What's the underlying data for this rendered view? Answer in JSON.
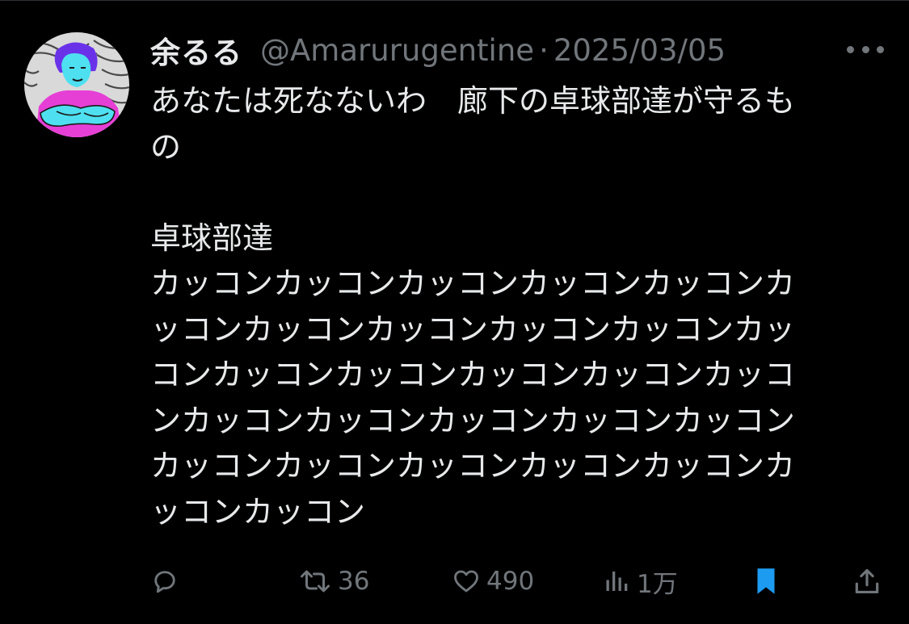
{
  "tweet": {
    "display_name": "余るる",
    "handle": "@Amarurugentine",
    "separator": "·",
    "date": "2025/03/05",
    "lines": [
      "あなたは死なないわ　廊下の卓球部達が守るも",
      "の",
      "",
      "卓球部達",
      "カッコンカッコンカッコンカッコンカッコンカ",
      "ッコンカッコンカッコンカッコンカッコンカッ",
      "コンカッコンカッコンカッコンカッコンカッコ",
      "ンカッコンカッコンカッコンカッコンカッコン",
      "カッコンカッコンカッコンカッコンカッコンカ",
      "ッコンカッコン"
    ]
  },
  "actions": {
    "reply": {
      "icon": "reply-icon",
      "count": ""
    },
    "retweet": {
      "icon": "retweet-icon",
      "count": "36"
    },
    "like": {
      "icon": "heart-icon",
      "count": "490"
    },
    "views": {
      "icon": "views-icon",
      "count": "1万"
    },
    "bookmark": {
      "icon": "bookmark-icon",
      "active": true
    },
    "share": {
      "icon": "share-icon"
    }
  },
  "colors": {
    "background": "#000000",
    "text": "#e7e9ea",
    "muted": "#71767b",
    "bookmark_active": "#1d9bf0",
    "avatar_figure": "#4ee0f0",
    "avatar_shirt": "#e63fd6",
    "avatar_hair": "#6a32e8"
  }
}
